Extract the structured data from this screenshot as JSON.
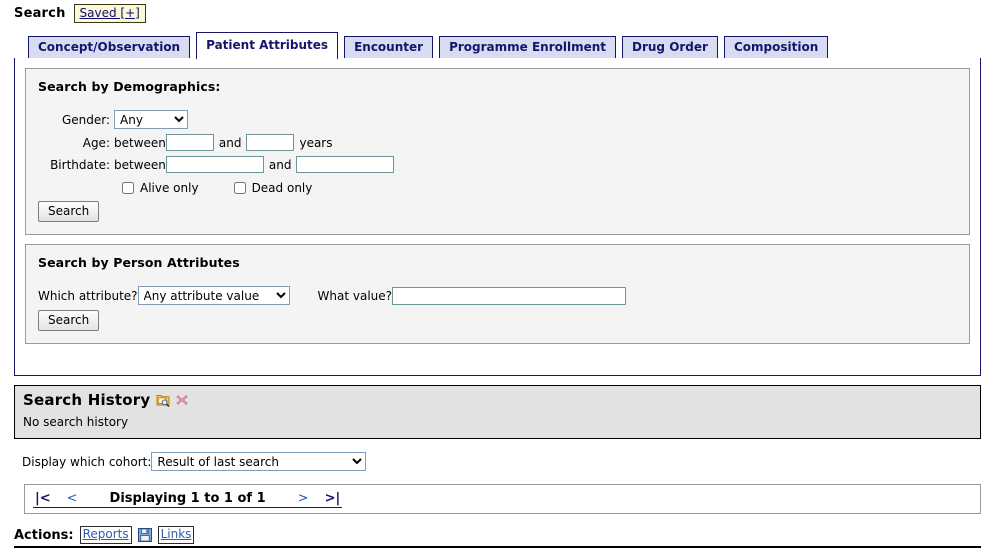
{
  "topbar": {
    "search_label": "Search",
    "saved_link": "Saved [+]"
  },
  "tabs": [
    {
      "label": "Concept/Observation",
      "active": false
    },
    {
      "label": "Patient Attributes",
      "active": true
    },
    {
      "label": "Encounter",
      "active": false
    },
    {
      "label": "Programme Enrollment",
      "active": false
    },
    {
      "label": "Drug Order",
      "active": false
    },
    {
      "label": "Composition",
      "active": false
    }
  ],
  "demographics": {
    "legend": "Search by Demographics:",
    "gender_label": "Gender:",
    "gender_value": "Any",
    "gender_options": [
      "Any"
    ],
    "age_label": "Age:",
    "age_between": "between",
    "age_and": "and",
    "age_units": "years",
    "age_min_value": "",
    "age_max_value": "",
    "birthdate_label": "Birthdate:",
    "birthdate_between": "between",
    "birthdate_and": "and",
    "birthdate_min_value": "",
    "birthdate_max_value": "",
    "alive_only_label": "Alive only",
    "alive_only_checked": false,
    "dead_only_label": "Dead only",
    "dead_only_checked": false,
    "search_button": "Search"
  },
  "person_attributes": {
    "legend": "Search by Person Attributes",
    "which_attribute_label": "Which attribute?",
    "attribute_value": "Any attribute value",
    "attribute_options": [
      "Any attribute value"
    ],
    "what_value_label": "What value?",
    "what_value_text": "",
    "search_button": "Search"
  },
  "search_history": {
    "title": "Search History",
    "empty_text": "No search history",
    "view_icon": "folder-search-icon",
    "delete_icon": "delete-x-icon"
  },
  "cohort": {
    "label": "Display which cohort:",
    "value": "Result of last search",
    "options": [
      "Result of last search"
    ]
  },
  "pagination": {
    "first": "|<",
    "prev": "<",
    "status": "Displaying 1 to 1 of 1",
    "next": ">",
    "last": ">|"
  },
  "actions": {
    "label": "Actions:",
    "reports_link": "Reports",
    "save_icon": "floppy-save-icon",
    "links_link": "Links"
  },
  "colors": {
    "tab_border": "#15156b",
    "tab_inactive_bg": "#d8dcf0",
    "tab_text": "#15156b",
    "fieldset_bg": "#f4f4f4",
    "history_bg": "#e2e2e2",
    "link_blue": "#2a5db0",
    "saved_bg": "#fbf8d8",
    "input_border": "#6e9598"
  }
}
